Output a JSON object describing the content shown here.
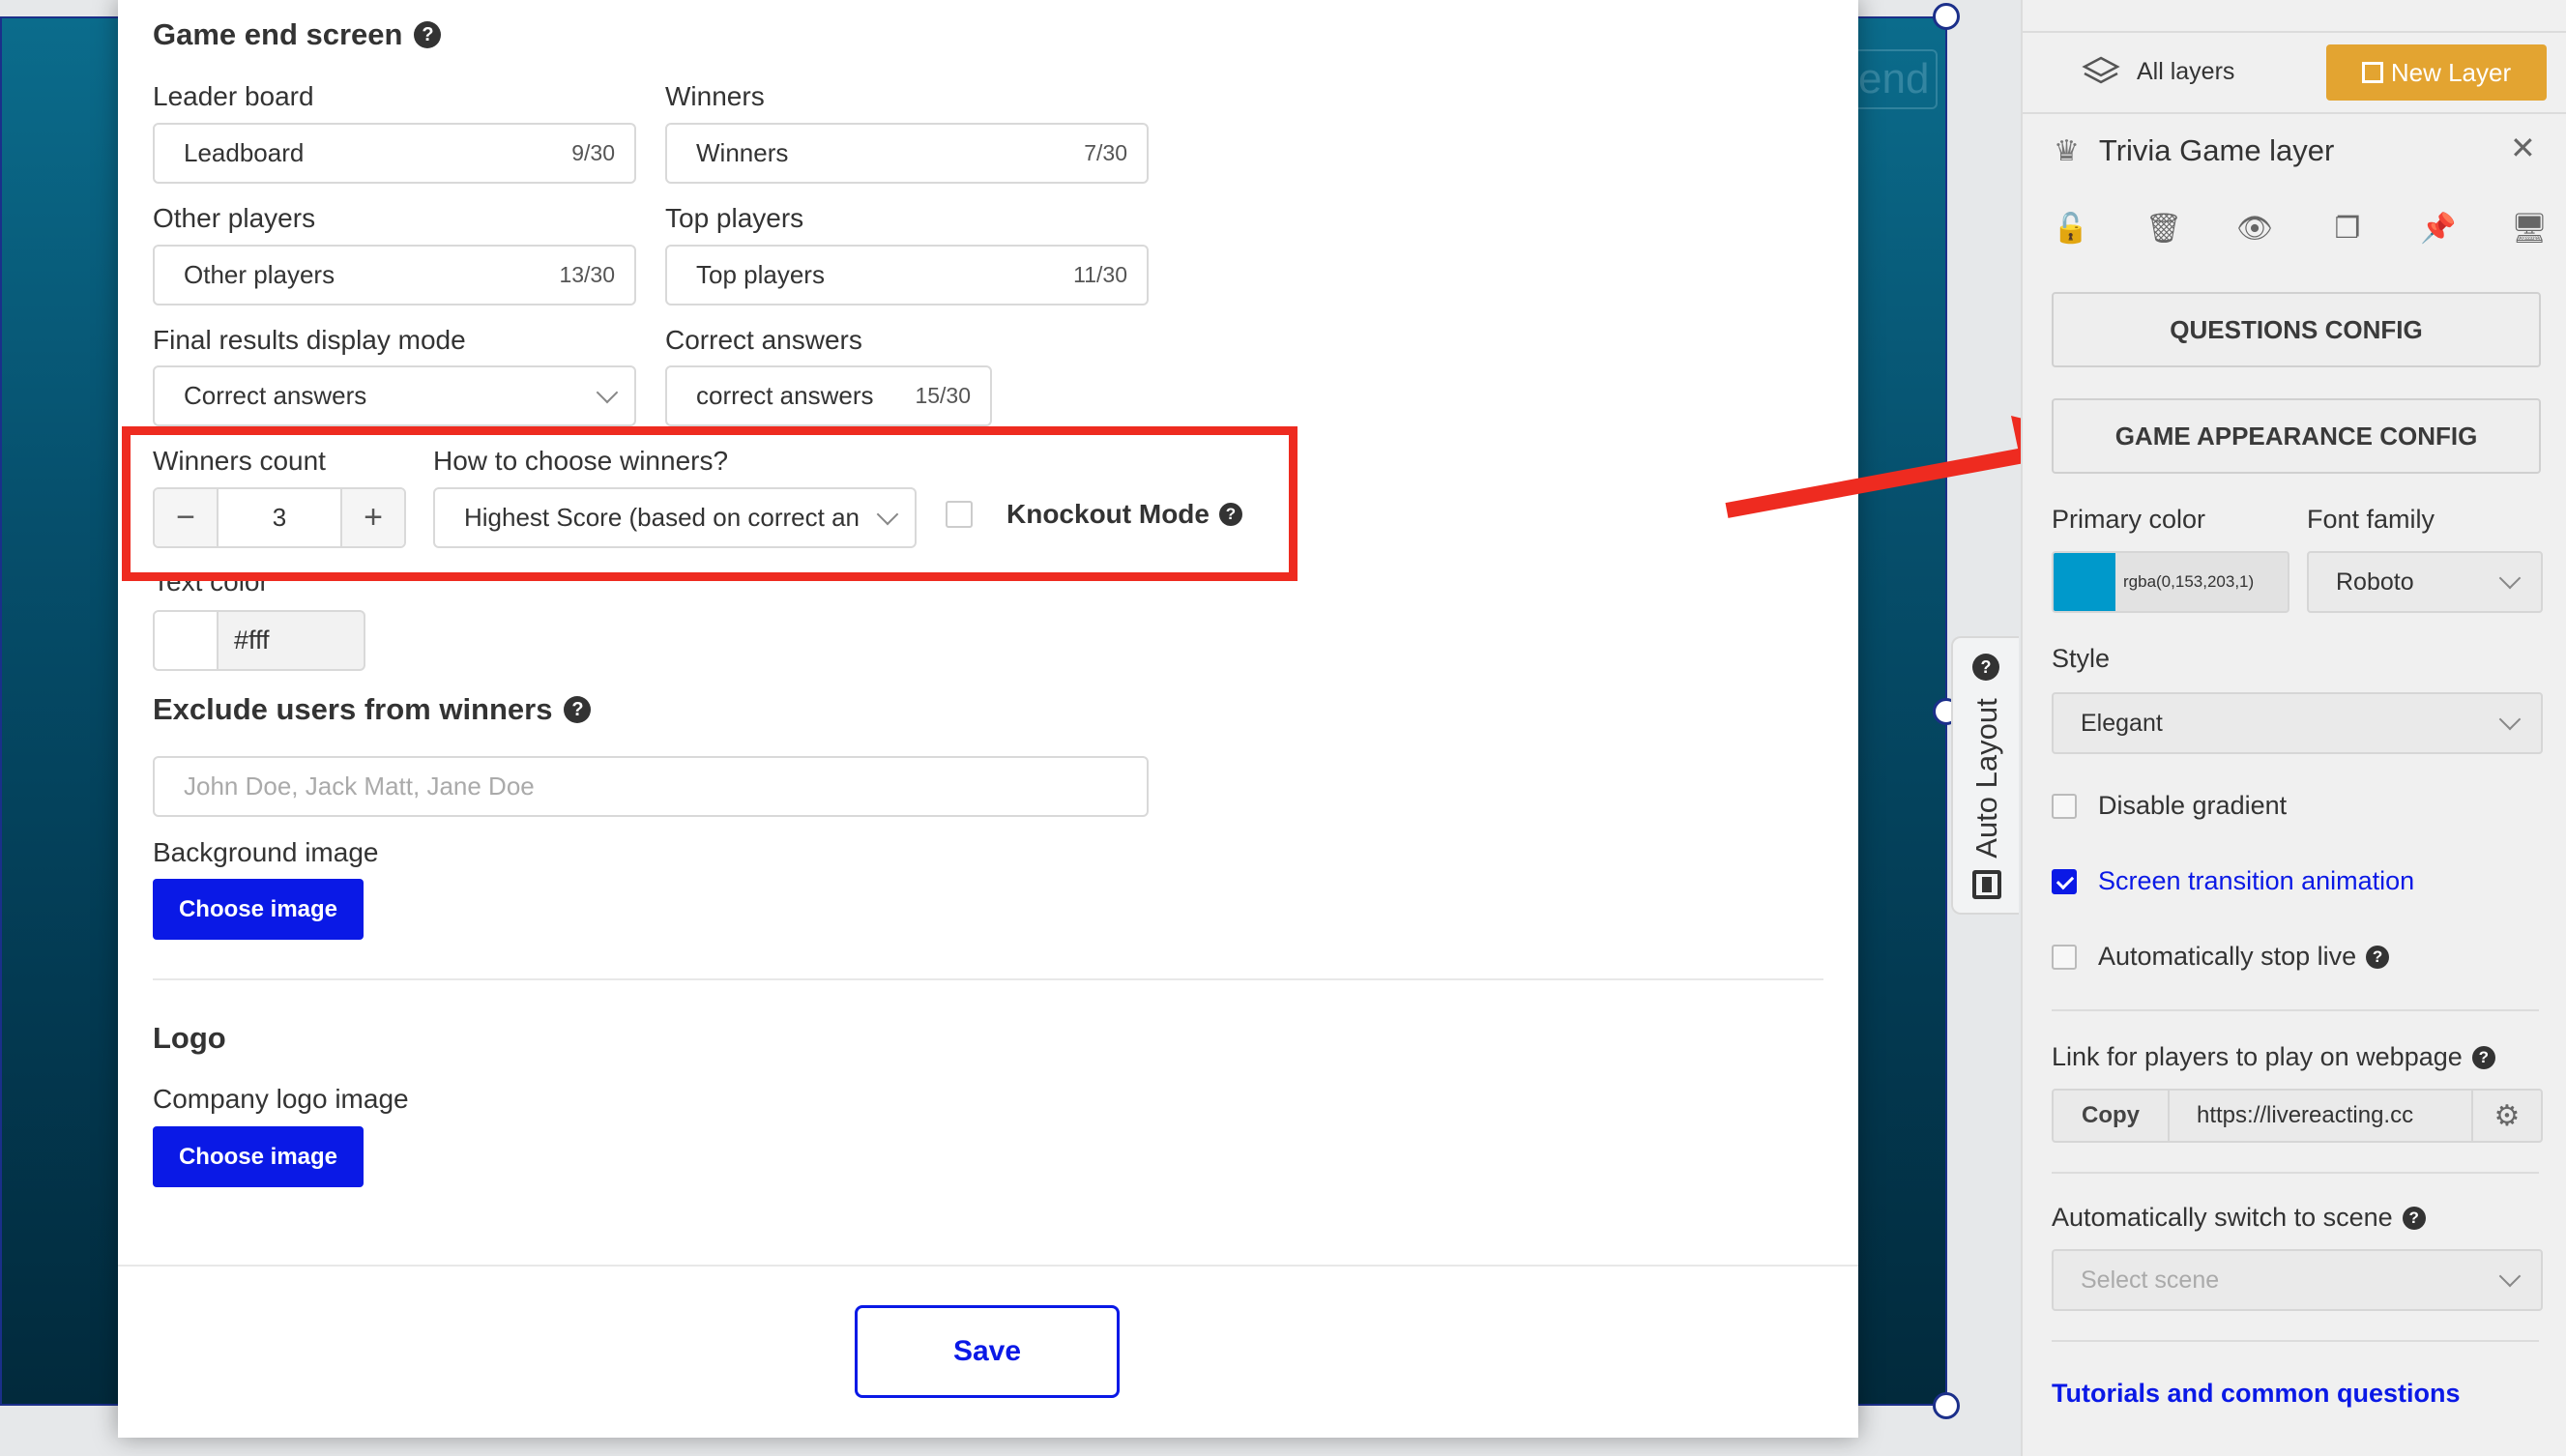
{
  "canvas": {
    "label": "end"
  },
  "auto_layout": {
    "label": "Auto Layout"
  },
  "modal": {
    "section_title": "Game end screen",
    "fields": {
      "leaderboard": {
        "label": "Leader board",
        "value": "Leadboard",
        "count": "9/30"
      },
      "winners": {
        "label": "Winners",
        "value": "Winners",
        "count": "7/30"
      },
      "other_players": {
        "label": "Other players",
        "value": "Other players",
        "count": "13/30"
      },
      "top_players": {
        "label": "Top players",
        "value": "Top players",
        "count": "11/30"
      },
      "final_results": {
        "label": "Final results display mode",
        "value": "Correct answers"
      },
      "correct_answers": {
        "label": "Correct answers",
        "value": "correct answers",
        "count": "15/30"
      },
      "winners_count": {
        "label": "Winners count",
        "value": "3",
        "minus": "−",
        "plus": "+"
      },
      "choose_winners": {
        "label": "How to choose winners?",
        "value": "Highest Score (based on correct an"
      },
      "knockout": {
        "label": "Knockout Mode",
        "checked": false
      },
      "text_color": {
        "label": "Text color",
        "value": "#fff",
        "swatch": "#ffffff"
      }
    },
    "exclude": {
      "title": "Exclude users from winners",
      "placeholder": "John Doe, Jack Matt, Jane Doe"
    },
    "background": {
      "label": "Background image",
      "button": "Choose image"
    },
    "logo": {
      "title": "Logo",
      "label": "Company logo image",
      "button": "Choose image"
    },
    "save_button": "Save",
    "help_glyph": "?"
  },
  "panel": {
    "all_layers": "All layers",
    "new_layer": "New Layer",
    "layer_title": "Trivia Game layer",
    "close": "✕",
    "questions_config": "QUESTIONS CONFIG",
    "appearance_config": "GAME APPEARANCE CONFIG",
    "primary_color": {
      "label": "Primary color",
      "value": "rgba(0,153,203,1)",
      "swatch": "#0099cb"
    },
    "font_family": {
      "label": "Font family",
      "value": "Roboto"
    },
    "style": {
      "label": "Style",
      "value": "Elegant"
    },
    "disable_gradient": {
      "label": "Disable gradient",
      "checked": false
    },
    "screen_transition": {
      "label": "Screen transition animation",
      "checked": true
    },
    "auto_stop_live": {
      "label": "Automatically stop live",
      "checked": false
    },
    "link": {
      "label": "Link for players to play on webpage",
      "copy": "Copy",
      "url": "https://livereacting.cc"
    },
    "auto_switch": {
      "label": "Automatically switch to scene",
      "placeholder": "Select scene"
    },
    "tutorials": "Tutorials and common questions"
  },
  "colors": {
    "accent": "#0a19e6",
    "highlight": "#ee2b20",
    "gold": "#e3a431"
  }
}
